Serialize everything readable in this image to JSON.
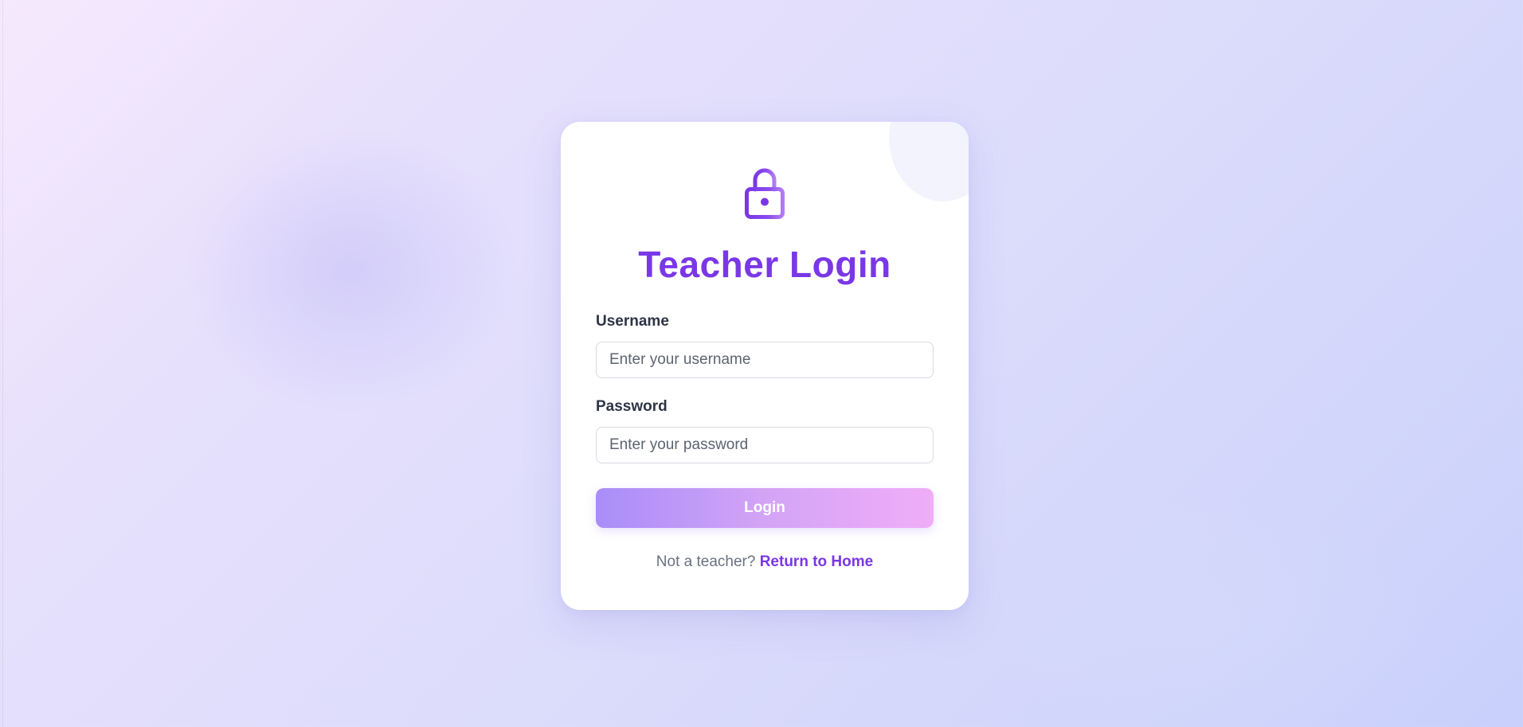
{
  "login": {
    "title": "Teacher Login",
    "username_label": "Username",
    "username_placeholder": "Enter your username",
    "username_value": "",
    "password_label": "Password",
    "password_placeholder": "Enter your password",
    "password_value": "",
    "submit_label": "Login",
    "footer_text": "Not a teacher?",
    "footer_link": "Return to Home",
    "icon": "lock-icon"
  },
  "colors": {
    "accent": "#7a37e7",
    "button_gradient_start": "#a98df8",
    "button_gradient_end": "#f0adf8",
    "label_text": "#2c3445",
    "muted_text": "#6a7080"
  }
}
